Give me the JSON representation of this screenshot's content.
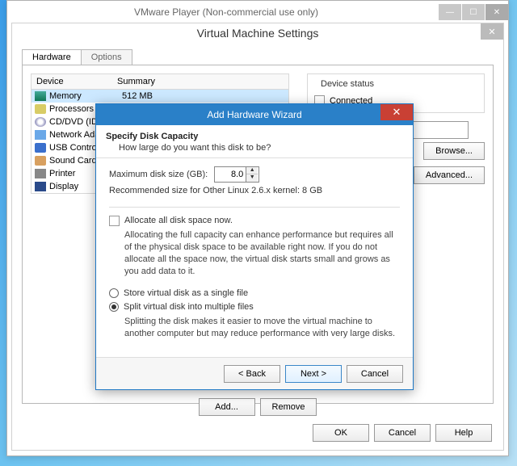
{
  "bg_window": {
    "title": "VMware Player (Non-commercial use only)"
  },
  "main_window": {
    "title": "Virtual Machine Settings"
  },
  "tabs": {
    "hardware": "Hardware",
    "options": "Options"
  },
  "device_headers": {
    "device": "Device",
    "summary": "Summary"
  },
  "devices": [
    {
      "name": "Memory",
      "summary": "512 MB",
      "icon": "ico-mem",
      "selected": true
    },
    {
      "name": "Processors",
      "summary": "",
      "icon": "ico-cpu"
    },
    {
      "name": "CD/DVD (IDE)",
      "summary": "",
      "icon": "ico-cd"
    },
    {
      "name": "Network Adap",
      "summary": "",
      "icon": "ico-net"
    },
    {
      "name": "USB Controller",
      "summary": "",
      "icon": "ico-usb"
    },
    {
      "name": "Sound Card",
      "summary": "",
      "icon": "ico-snd"
    },
    {
      "name": "Printer",
      "summary": "",
      "icon": "ico-prn"
    },
    {
      "name": "Display",
      "summary": "",
      "icon": "ico-dsp"
    }
  ],
  "device_status": {
    "label": "Device status",
    "connected": "Connected"
  },
  "right_buttons": {
    "browse": "Browse...",
    "advanced": "Advanced..."
  },
  "bottom_buttons": {
    "add": "Add...",
    "remove": "Remove"
  },
  "dialog_buttons": {
    "ok": "OK",
    "cancel": "Cancel",
    "help": "Help"
  },
  "wizard": {
    "title": "Add Hardware Wizard",
    "header_title": "Specify Disk Capacity",
    "header_sub": "How large do you want this disk to be?",
    "max_size_label": "Maximum disk size (GB):",
    "max_size_value": "8.0",
    "recommended": "Recommended size for Other Linux 2.6.x kernel: 8 GB",
    "allocate_label": "Allocate all disk space now.",
    "allocate_desc": "Allocating the full capacity can enhance performance but requires all of the physical disk space to be available right now. If you do not allocate all the space now, the virtual disk starts small and grows as you add data to it.",
    "radio_single": "Store virtual disk as a single file",
    "radio_split": "Split virtual disk into multiple files",
    "split_desc": "Splitting the disk makes it easier to move the virtual machine to another computer but may reduce performance with very large disks.",
    "back": "< Back",
    "next": "Next >",
    "cancel": "Cancel"
  }
}
